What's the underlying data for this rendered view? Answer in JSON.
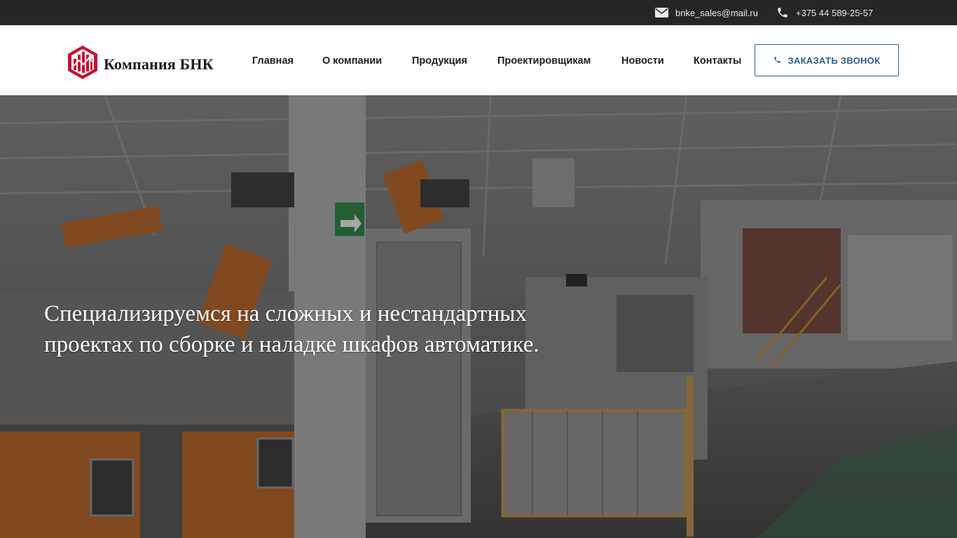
{
  "topbar": {
    "email": {
      "icon": "envelope-icon",
      "text": "bnke_sales@mail.ru"
    },
    "phone": {
      "icon": "phone-icon",
      "text": "+375 44 589-25-57"
    }
  },
  "header": {
    "logo_text": "Компания БНК",
    "logo_icon": "company-logo-icon",
    "nav": [
      {
        "label": "Главная"
      },
      {
        "label": "О компании"
      },
      {
        "label": "Продукция"
      },
      {
        "label": "Проектировщикам"
      },
      {
        "label": "Новости"
      },
      {
        "label": "Контакты"
      }
    ],
    "cta": {
      "icon": "phone-icon",
      "label": "ЗАКАЗАТЬ ЗВОНОК"
    }
  },
  "hero": {
    "title": "Специализируемся на сложных и нестандартных проектах по сборке и наладке шкафов автоматике.",
    "background": "factory-production-line-photo"
  },
  "colors": {
    "topbar_bg": "#252525",
    "header_bg": "#ffffff",
    "accent_blue": "#2a5d8f",
    "logo_red": "#c8102e"
  }
}
